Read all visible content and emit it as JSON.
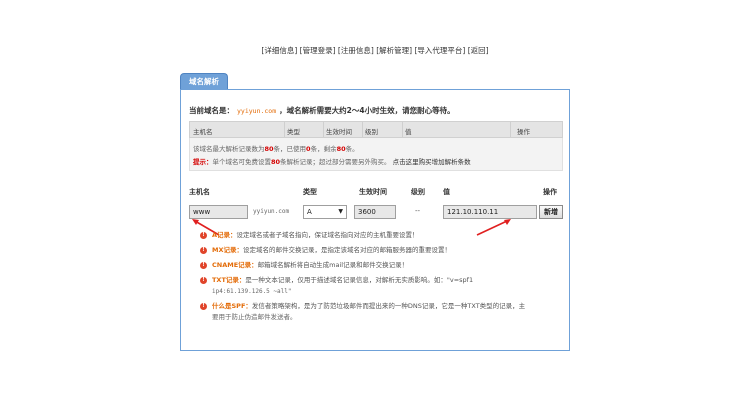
{
  "nav": {
    "items": [
      "详细信息",
      "管理登录",
      "注册信息",
      "解析管理",
      "导入代理平台",
      "返回"
    ]
  },
  "panel": {
    "tab_label": "域名解析",
    "domain_prefix": "当前域名是：",
    "domain": "yyiyun.com",
    "domain_suffix": "，域名解析需要大约2～4小时生效，请您耐心等待。"
  },
  "records_table": {
    "columns": [
      "主机名",
      "类型",
      "生效时间",
      "级别",
      "值",
      "操作"
    ]
  },
  "info": {
    "line1_a": "该域名最大解析记录数为",
    "max": "80",
    "line1_b": "条，已使用",
    "used": "0",
    "line1_c": "条，剩余",
    "remain": "80",
    "line1_d": "条。",
    "tip_label": "提示：",
    "line2_a": "单个域名可免费设置",
    "free": "80",
    "line2_b": "条解析记录；超过部分需要另外购买。",
    "buy_link": "点击这里购买增加解析条数"
  },
  "form": {
    "headers": {
      "host": "主机名",
      "type": "类型",
      "ttl": "生效时间",
      "level": "级别",
      "value": "值",
      "action": "操作"
    },
    "host_value": "www",
    "domain_suffix": "yyiyun.com",
    "type_value": "A",
    "ttl_value": "3600",
    "level_value": "--",
    "value_value": "121.10.110.11",
    "add_button": "新增"
  },
  "notes": [
    {
      "label": "A记录：",
      "text": "设定域名或者子域名指向，保证域名指向对应的主机重要设置！",
      "sub": ""
    },
    {
      "label": "MX记录：",
      "text": "设定域名的邮件交换记录，是指定该域名对应的邮箱服务器的重要设置！",
      "sub": ""
    },
    {
      "label": "CNAME记录：",
      "text": "邮箱域名解析将自动生成mail记录和邮件交换记录！",
      "sub": ""
    },
    {
      "label": "TXT记录：",
      "text": "是一种文本记录，仅用于描述域名记录信息，对解析无实质影响。如：\"v=spf1",
      "sub": "ip4:61.139.126.5 ~all\""
    },
    {
      "label": "什么是SPF：",
      "text": "发信者策略架构，是为了防范垃圾邮件而提出来的一种DNS记录，它是一种TXT类型的记录，主",
      "sub": "要用于防止伪造邮件发送者。"
    }
  ],
  "colors": {
    "panel_border": "#6fa1d8",
    "tab_bg": "#6fa1d8",
    "warning_red": "#d40000",
    "accent_orange": "#e36c09",
    "arrow_red": "#e02020"
  }
}
